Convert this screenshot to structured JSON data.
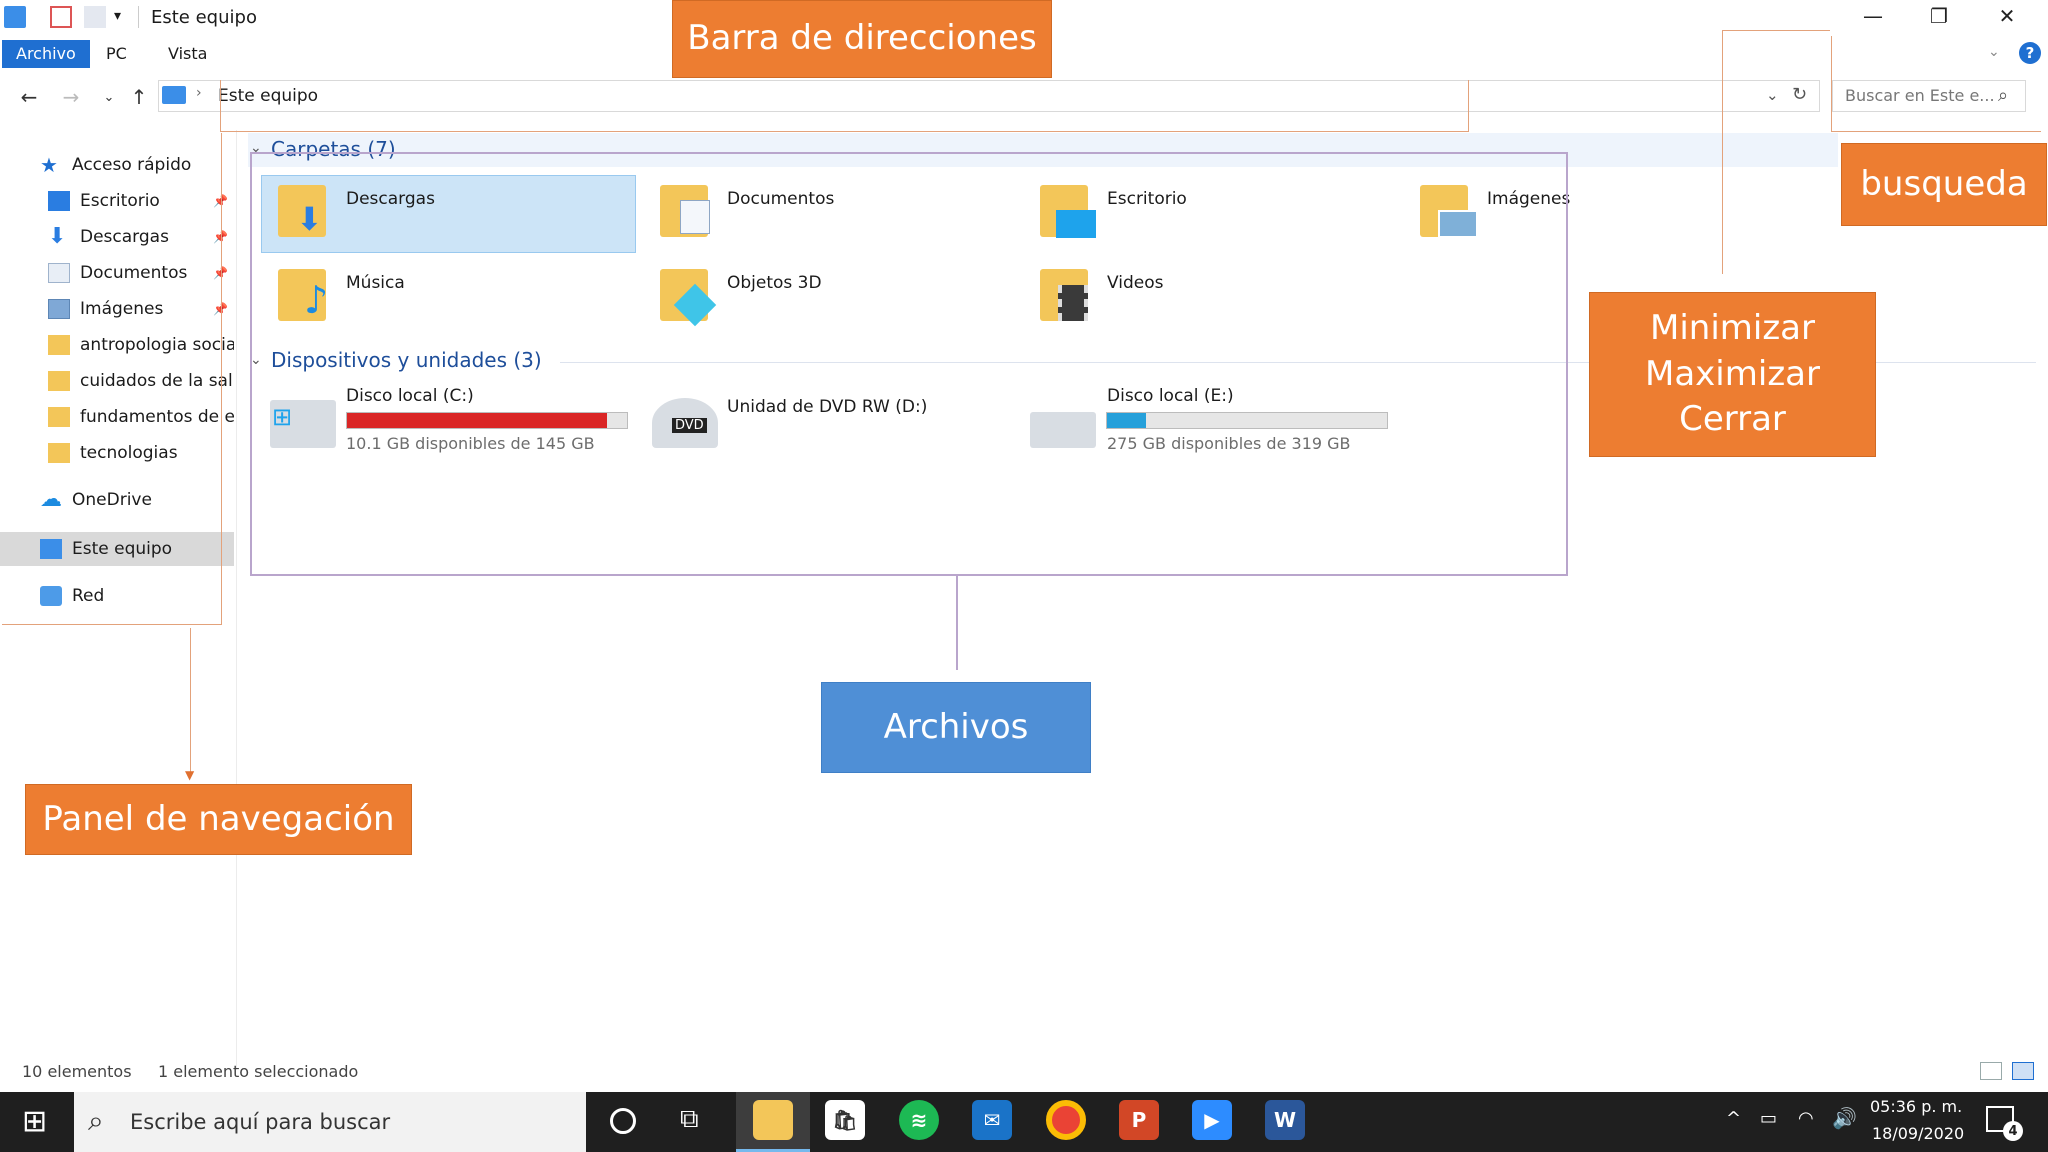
{
  "window": {
    "title": "Este equipo",
    "ribbon_tabs": [
      "Archivo",
      "PC",
      "Vista"
    ],
    "address": "Este equipo",
    "search_placeholder": "Buscar en Este e..."
  },
  "nav_pane": {
    "quick_access": "Acceso rápido",
    "items": [
      {
        "label": "Escritorio",
        "pinned": true
      },
      {
        "label": "Descargas",
        "pinned": true
      },
      {
        "label": "Documentos",
        "pinned": true
      },
      {
        "label": "Imágenes",
        "pinned": true
      },
      {
        "label": "antropologia social",
        "pinned": false
      },
      {
        "label": "cuidados de la salu",
        "pinned": false
      },
      {
        "label": "fundamentos de en",
        "pinned": false
      },
      {
        "label": "tecnologias",
        "pinned": false
      }
    ],
    "onedrive": "OneDrive",
    "this_pc": "Este equipo",
    "network": "Red"
  },
  "content": {
    "folders_group": "Carpetas (7)",
    "folders": [
      "Descargas",
      "Documentos",
      "Escritorio",
      "Imágenes",
      "Música",
      "Objetos 3D",
      "Videos"
    ],
    "devices_group": "Dispositivos y unidades (3)",
    "drives": [
      {
        "name": "Disco local (C:)",
        "free_text": "10.1 GB disponibles de 145 GB",
        "used_fraction": 0.93,
        "bar_color": "#da2626"
      },
      {
        "name": "Unidad de DVD RW (D:)",
        "badge": "DVD"
      },
      {
        "name": "Disco local (E:)",
        "free_text": "275 GB disponibles de 319 GB",
        "used_fraction": 0.14,
        "bar_color": "#26a0da"
      }
    ]
  },
  "annotations": {
    "address_bar": "Barra de direcciones",
    "search": "busqueda",
    "window_controls": [
      "Minimizar",
      "Maximizar",
      "Cerrar"
    ],
    "files": "Archivos",
    "nav_panel": "Panel de navegación"
  },
  "status_bar": {
    "count": "10 elementos",
    "selected": "1 elemento seleccionado"
  },
  "taskbar": {
    "search_text": "Escribe aquí para buscar",
    "time": "05:36 p. m.",
    "date": "18/09/2020",
    "notification_count": "4",
    "apps": [
      "file-explorer",
      "store",
      "spotify",
      "mail",
      "chrome",
      "powerpoint",
      "zoom",
      "word"
    ]
  },
  "colors": {
    "accent": "#1f6fd1",
    "callout_orange": "#ed7d31",
    "callout_blue": "#4f8fd6"
  }
}
